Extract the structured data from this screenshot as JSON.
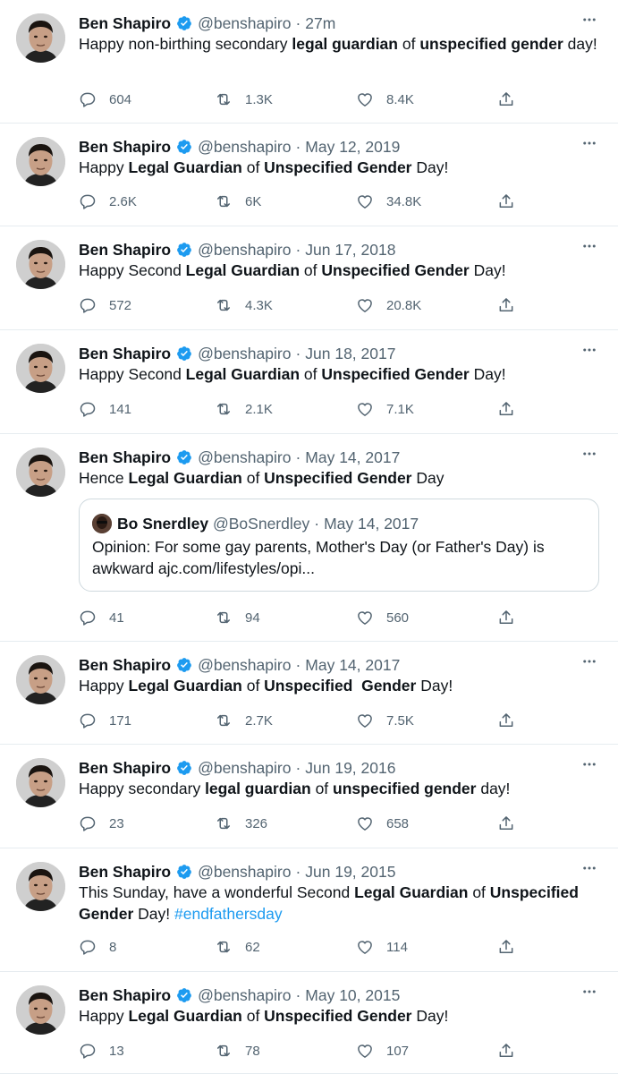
{
  "colors": {
    "accent": "#1d9bf0",
    "muted": "#536471",
    "text": "#0f1419",
    "divider": "#e6ecf0"
  },
  "tweets": [
    {
      "name": "Ben Shapiro",
      "handle": "@benshapiro",
      "date": "27m",
      "parts": [
        [
          "Happy non-birthing secondary ",
          ""
        ],
        [
          "legal guardian",
          "b"
        ],
        [
          " of ",
          ""
        ],
        [
          "unspecified gender",
          "b"
        ],
        [
          " day!",
          ""
        ]
      ],
      "replies": "604",
      "retweets": "1.3K",
      "likes": "8.4K"
    },
    {
      "name": "Ben Shapiro",
      "handle": "@benshapiro",
      "date": "May 12, 2019",
      "parts": [
        [
          "Happy ",
          ""
        ],
        [
          "Legal Guardian",
          "b"
        ],
        [
          " of ",
          ""
        ],
        [
          "Unspecified Gender",
          "b"
        ],
        [
          " Day!",
          ""
        ]
      ],
      "replies": "2.6K",
      "retweets": "6K",
      "likes": "34.8K"
    },
    {
      "name": "Ben Shapiro",
      "handle": "@benshapiro",
      "date": "Jun 17, 2018",
      "parts": [
        [
          "Happy Second ",
          ""
        ],
        [
          "Legal Guardian",
          "b"
        ],
        [
          " of ",
          ""
        ],
        [
          "Unspecified Gender",
          "b"
        ],
        [
          " Day!",
          ""
        ]
      ],
      "replies": "572",
      "retweets": "4.3K",
      "likes": "20.8K"
    },
    {
      "name": "Ben Shapiro",
      "handle": "@benshapiro",
      "date": "Jun 18, 2017",
      "parts": [
        [
          "Happy Second ",
          ""
        ],
        [
          "Legal Guardian",
          "b"
        ],
        [
          " of ",
          ""
        ],
        [
          "Unspecified Gender",
          "b"
        ],
        [
          " Day!",
          ""
        ]
      ],
      "replies": "141",
      "retweets": "2.1K",
      "likes": "7.1K"
    },
    {
      "name": "Ben Shapiro",
      "handle": "@benshapiro",
      "date": "May 14, 2017",
      "parts": [
        [
          "Hence ",
          ""
        ],
        [
          "Legal Guardian",
          "b"
        ],
        [
          " of ",
          ""
        ],
        [
          "Unspecified Gender",
          "b"
        ],
        [
          " Day",
          ""
        ]
      ],
      "quote": {
        "name": "Bo Snerdley",
        "handle": "@BoSnerdley",
        "date": "May 14, 2017",
        "text": "Opinion: For some gay parents, Mother's Day (or Father's Day) is awkward ajc.com/lifestyles/opi..."
      },
      "replies": "41",
      "retweets": "94",
      "likes": "560"
    },
    {
      "name": "Ben Shapiro",
      "handle": "@benshapiro",
      "date": "May 14, 2017",
      "parts": [
        [
          "Happy ",
          ""
        ],
        [
          "Legal Guardian",
          "b"
        ],
        [
          " of ",
          ""
        ],
        [
          "Unspecified  Gender",
          "b"
        ],
        [
          " Day!",
          ""
        ]
      ],
      "replies": "171",
      "retweets": "2.7K",
      "likes": "7.5K"
    },
    {
      "name": "Ben Shapiro",
      "handle": "@benshapiro",
      "date": "Jun 19, 2016",
      "parts": [
        [
          "Happy secondary ",
          ""
        ],
        [
          "legal guardian",
          "b"
        ],
        [
          " of ",
          ""
        ],
        [
          "unspecified gender",
          "b"
        ],
        [
          " day!",
          ""
        ]
      ],
      "replies": "23",
      "retweets": "326",
      "likes": "658"
    },
    {
      "name": "Ben Shapiro",
      "handle": "@benshapiro",
      "date": "Jun 19, 2015",
      "parts": [
        [
          "This Sunday, have a wonderful Second ",
          ""
        ],
        [
          "Legal Guardian",
          "b"
        ],
        [
          " of ",
          ""
        ],
        [
          "Unspecified Gender",
          "b"
        ],
        [
          " Day! ",
          ""
        ],
        [
          "#endfathersday",
          "tag"
        ]
      ],
      "replies": "8",
      "retweets": "62",
      "likes": "114"
    },
    {
      "name": "Ben Shapiro",
      "handle": "@benshapiro",
      "date": "May 10, 2015",
      "parts": [
        [
          "Happy ",
          ""
        ],
        [
          "Legal Guardian",
          "b"
        ],
        [
          " of ",
          ""
        ],
        [
          "Unspecified Gender",
          "b"
        ],
        [
          " Day!",
          ""
        ]
      ],
      "replies": "13",
      "retweets": "78",
      "likes": "107"
    }
  ]
}
